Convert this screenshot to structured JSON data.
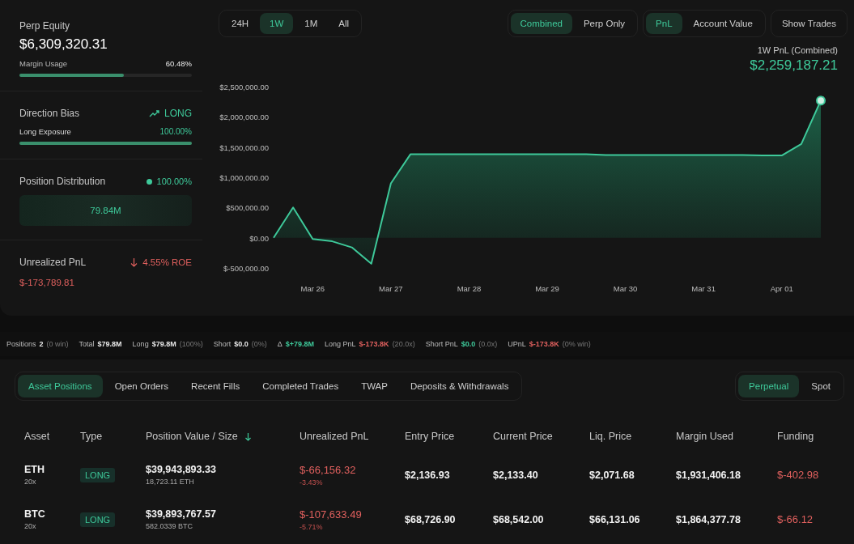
{
  "summary": {
    "equity_label": "Perp Equity",
    "equity": "$6,309,320.31",
    "margin": {
      "label": "Margin Usage",
      "value": "60.48%",
      "level": 0.6048
    },
    "bias_label": "Direction Bias",
    "bias_value": "LONG",
    "exposure": {
      "label": "Long Exposure",
      "value": "100.00%",
      "level": 1
    },
    "distribution_label": "Position Distribution",
    "distribution_value": "100.00%",
    "distribution_bar": "79.84M",
    "upnl_label": "Unrealized PnL",
    "roe": "4.55% ROE",
    "upnl": "$-173,789.81"
  },
  "periods": [
    {
      "label": "24H",
      "selected": false
    },
    {
      "label": "1W",
      "selected": true
    },
    {
      "label": "1M",
      "selected": false
    },
    {
      "label": "All",
      "selected": false
    }
  ],
  "modes": [
    {
      "label": "Combined",
      "selected": true
    },
    {
      "label": "Perp Only",
      "selected": false
    }
  ],
  "metrics": [
    {
      "label": "PnL",
      "selected": true
    },
    {
      "label": "Account Value",
      "selected": false
    }
  ],
  "show_trades": "Show Trades",
  "pnl_title": "1W PnL (Combined)",
  "pnl_value": "$2,259,187.21",
  "chart_data": {
    "type": "area",
    "categories": [
      null,
      null,
      "Mar 26",
      null,
      null,
      null,
      "Mar 27",
      null,
      null,
      null,
      "Mar 28",
      null,
      null,
      null,
      "Mar 29",
      null,
      null,
      null,
      "Mar 30",
      null,
      null,
      null,
      "Mar 31",
      null,
      null,
      null,
      "Apr 01",
      null,
      null
    ],
    "series": [
      {
        "color": "#3ec99a",
        "values": [
          0,
          500000,
          -20000,
          -60000,
          -160000,
          -430000,
          900000,
          1380000,
          1380000,
          1380000,
          1380000,
          1380000,
          1380000,
          1380000,
          1380000,
          1380000,
          1380000,
          1370000,
          1370000,
          1370000,
          1370000,
          1370000,
          1370000,
          1370000,
          1370000,
          1360000,
          1360000,
          1550000,
          2270000
        ]
      }
    ],
    "ylim": [
      -500000,
      2500000
    ],
    "yticks": [
      {
        "value": 2500000,
        "label": "$2,500,000.00"
      },
      {
        "value": 2000000,
        "label": "$2,000,000.00"
      },
      {
        "value": 1500000,
        "label": "$1,500,000.00"
      },
      {
        "value": 1000000,
        "label": "$1,000,000.00"
      },
      {
        "value": 500000,
        "label": "$500,000.00"
      },
      {
        "value": 0,
        "label": "$0.00"
      },
      {
        "value": -500000,
        "label": "$-500,000.00"
      }
    ]
  },
  "stats": [
    {
      "label": "Positions",
      "value": "2",
      "note": "(0 win)",
      "color": "#e8e8e8"
    },
    {
      "label": "Total",
      "value": "$79.8M",
      "color": "#e8e8e8"
    },
    {
      "label": "Long",
      "value": "$79.8M",
      "note": "(100%)",
      "color": "#e8e8e8"
    },
    {
      "label": "Short",
      "value": "$0.0",
      "note": "(0%)",
      "color": "#e8e8e8"
    },
    {
      "label": "Δ",
      "value": "$+79.8M",
      "color": "#3ec99a"
    },
    {
      "label": "Long PnL",
      "value": "$-173.8K",
      "note": "(20.0x)",
      "color": "#e0605e"
    },
    {
      "label": "Short PnL",
      "value": "$0.0",
      "note": "(0.0x)",
      "color": "#3ec99a"
    },
    {
      "label": "UPnL",
      "value": "$-173.8K",
      "note": "(0% win)",
      "color": "#e0605e"
    }
  ],
  "sections": [
    {
      "label": "Asset Positions",
      "selected": true
    },
    {
      "label": "Open Orders",
      "selected": false
    },
    {
      "label": "Recent Fills",
      "selected": false
    },
    {
      "label": "Completed Trades",
      "selected": false
    },
    {
      "label": "TWAP",
      "selected": false
    },
    {
      "label": "Deposits & Withdrawals",
      "selected": false
    }
  ],
  "markets": [
    {
      "label": "Perpetual",
      "selected": true
    },
    {
      "label": "Spot",
      "selected": false
    }
  ],
  "table": {
    "columns": [
      "Asset",
      "Type",
      "Position Value / Size",
      "Unrealized PnL",
      "Entry Price",
      "Current Price",
      "Liq. Price",
      "Margin Used",
      "Funding"
    ],
    "rows": [
      {
        "asset": "ETH",
        "leverage": "20x",
        "type": "LONG",
        "value": "$39,943,893.33",
        "size": "18,723.11 ETH",
        "pnl": "$-66,156.32",
        "pnl_pct": "-3.43%",
        "entry": "$2,136.93",
        "current": "$2,133.40",
        "liq": "$2,071.68",
        "margin": "$1,931,406.18",
        "funding": "$-402.98"
      },
      {
        "asset": "BTC",
        "leverage": "20x",
        "type": "LONG",
        "value": "$39,893,767.57",
        "size": "582.0339 BTC",
        "pnl": "$-107,633.49",
        "pnl_pct": "-5.71%",
        "entry": "$68,726.90",
        "current": "$68,542.00",
        "liq": "$66,131.06",
        "margin": "$1,864,377.78",
        "funding": "$-66.12"
      }
    ]
  }
}
